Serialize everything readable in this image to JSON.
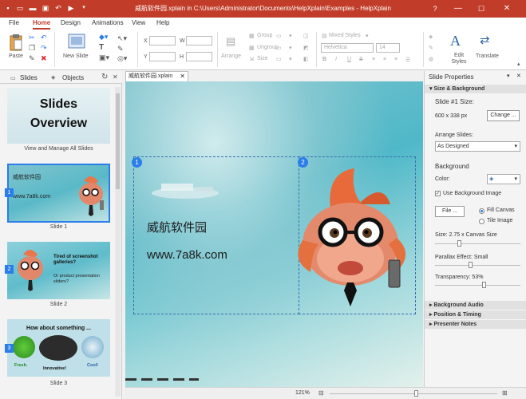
{
  "title": "威航软件园.xplain in C:\\Users\\Administrator\\Documents\\HelpXplain\\Examples - HelpXplain",
  "menu": {
    "file": "File",
    "home": "Home",
    "design": "Design",
    "animations": "Animations",
    "view": "View",
    "help": "Help"
  },
  "ribbon": {
    "paste": "Paste",
    "new_slide": "New Slide",
    "x_label": "X",
    "y_label": "Y",
    "w_label": "W",
    "h_label": "H",
    "arrange": "Arrange",
    "group": "Group",
    "ungroup": "Ungroup",
    "size": "Size",
    "mixed_styles": "Mixed Styles",
    "font": "Helvetica",
    "font_size": "14",
    "bold": "B",
    "italic": "I",
    "underline": "U",
    "strike": "S",
    "edit_styles": "Edit Styles",
    "translate": "Translate"
  },
  "left_panel": {
    "tab_slides": "Slides",
    "tab_objects": "Objects",
    "overview_line1": "Slides",
    "overview_line2": "Overview",
    "overview_caption": "View and Manage All Slides",
    "slides": [
      {
        "num": "1",
        "label": "Slide 1",
        "text1": "威航软件园",
        "text2": "www.7a8k.com"
      },
      {
        "num": "2",
        "label": "Slide 2",
        "text1": "Tired of screenshot galleries?",
        "text2": "Or product presentation sliders?"
      },
      {
        "num": "3",
        "label": "Slide 3",
        "text1": "How about something ...",
        "fresh": "Fresh.",
        "innovative": "Innovative!",
        "cool": "Cool!"
      }
    ]
  },
  "doc_tab": "威航软件园.xplain",
  "canvas": {
    "text1": "威航软件园",
    "text2": "www.7a8k.com",
    "badge1": "1",
    "badge2": "2"
  },
  "status": {
    "zoom": "121%"
  },
  "props": {
    "title": "Slide Properties",
    "section_size": "Size & Background",
    "slide_size_label": "Slide #1 Size:",
    "size_value": "600 x 338 px",
    "change_btn": "Change ...",
    "arrange_label": "Arrange Slides:",
    "arrange_value": "As Designed",
    "background_label": "Background",
    "color_label": "Color:",
    "use_bg_image": "Use Background Image",
    "file_btn": "File ...",
    "fill_canvas": "Fill Canvas",
    "tile_image": "Tile Image",
    "size_canvas": "Size: 2.75 x Canvas Size",
    "parallax": "Parallax Effect: Small",
    "transparency": "Transparency: 53%",
    "section_audio": "Background Audio",
    "section_position": "Position & Timing",
    "section_notes": "Presenter Notes"
  },
  "colors": {
    "accent": "#c13d29",
    "selection": "#2b7de9"
  }
}
